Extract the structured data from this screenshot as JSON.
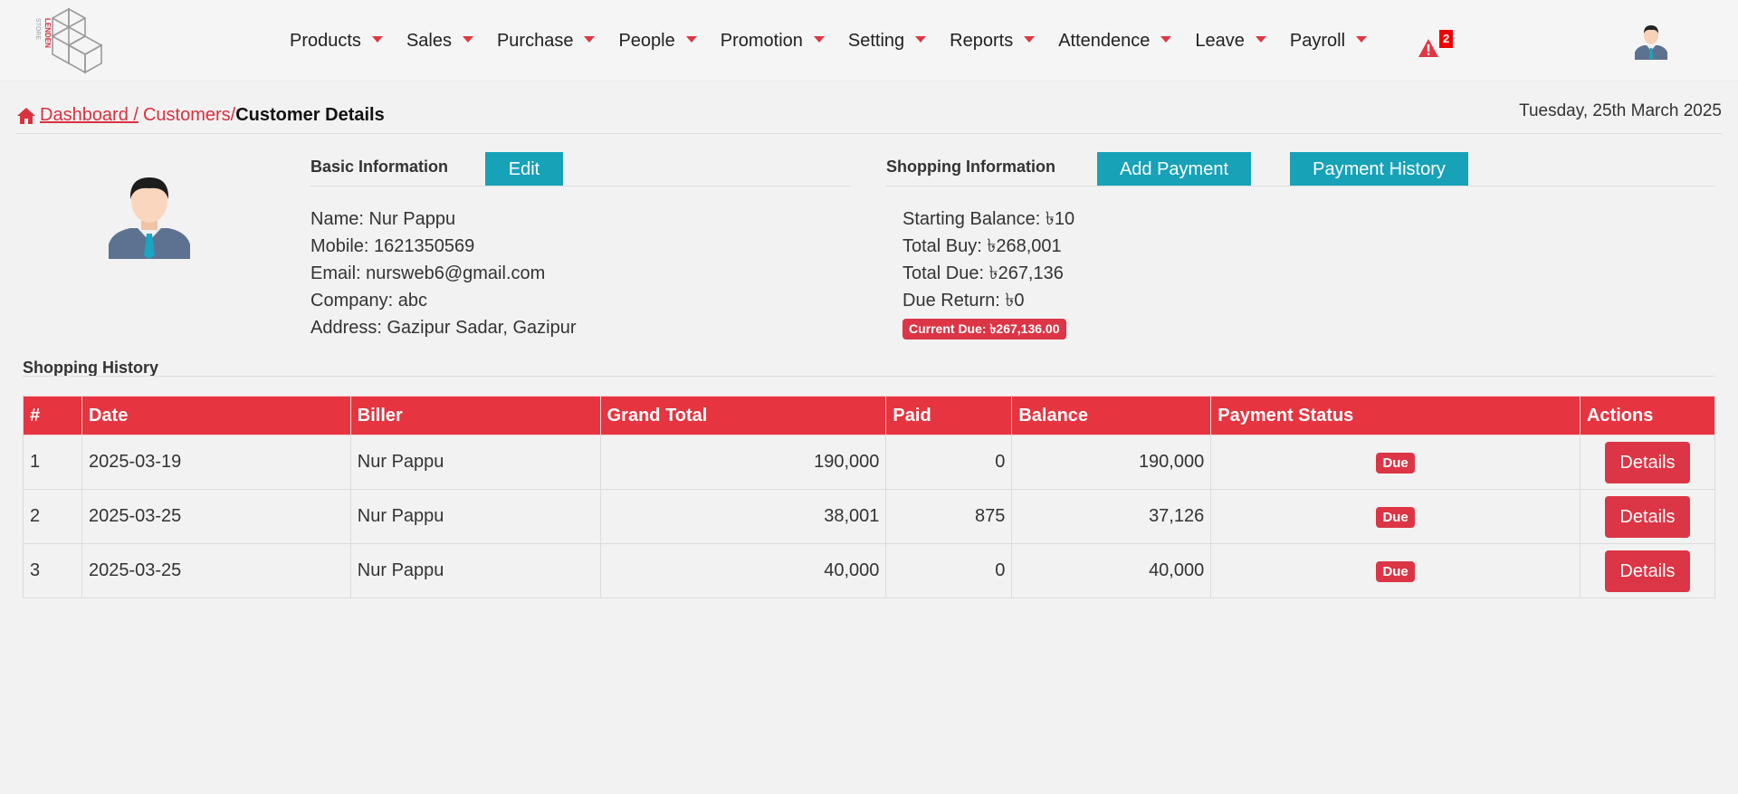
{
  "nav": {
    "logo_text": "LENDEN STORE",
    "items": [
      {
        "label": "Products"
      },
      {
        "label": "Sales"
      },
      {
        "label": "Purchase"
      },
      {
        "label": "People"
      },
      {
        "label": "Promotion"
      },
      {
        "label": "Setting"
      },
      {
        "label": "Reports"
      },
      {
        "label": "Attendence"
      },
      {
        "label": "Leave"
      },
      {
        "label": "Payroll"
      }
    ],
    "alert_count": "2",
    "accent_color": "#e23642"
  },
  "breadcrumb": {
    "dashboard": " Dashboard / ",
    "customers": "Customers",
    "separator": " /",
    "current": "Customer Details"
  },
  "date": "Tuesday, 25th March 2025",
  "basic": {
    "heading": "Basic Information",
    "edit_label": "Edit",
    "name": "Name: Nur Pappu",
    "mobile": "Mobile: 1621350569",
    "email": "Email: nursweb6@gmail.com",
    "company": "Company: abc",
    "address": "Address: Gazipur Sadar, Gazipur"
  },
  "shopping": {
    "heading": "Shopping Information",
    "add_payment_label": "Add Payment",
    "payment_history_label": "Payment History",
    "starting_balance": "Starting Balance: ৳10",
    "total_buy": "Total Buy: ৳268,001",
    "total_due": "Total Due: ৳267,136",
    "due_return": "Due Return: ৳0",
    "current_due": "Current Due: ৳267,136.00"
  },
  "history": {
    "heading": "Shopping History",
    "columns": [
      "#",
      "Date",
      "Biller",
      "Grand Total",
      "Paid",
      "Balance",
      "Payment Status",
      "Actions"
    ],
    "rows": [
      {
        "no": "1",
        "date": "2025-03-19",
        "biller": "Nur Pappu",
        "grand_total": "190,000",
        "paid": "0",
        "balance": "190,000",
        "status": "Due",
        "action": "Details"
      },
      {
        "no": "2",
        "date": "2025-03-25",
        "biller": "Nur Pappu",
        "grand_total": "38,001",
        "paid": "875",
        "balance": "37,126",
        "status": "Due",
        "action": "Details"
      },
      {
        "no": "3",
        "date": "2025-03-25",
        "biller": "Nur Pappu",
        "grand_total": "40,000",
        "paid": "0",
        "balance": "40,000",
        "status": "Due",
        "action": "Details"
      }
    ]
  },
  "colors": {
    "teal": "#17a2b8",
    "red": "#dc3545",
    "header_red": "#e63440"
  }
}
